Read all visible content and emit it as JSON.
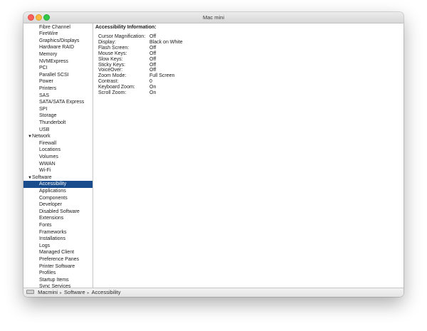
{
  "window": {
    "title": "Mac mini"
  },
  "sidebar": {
    "items": [
      {
        "label": "Fibre Channel",
        "level": "sub"
      },
      {
        "label": "FireWire",
        "level": "sub"
      },
      {
        "label": "Graphics/Displays",
        "level": "sub"
      },
      {
        "label": "Hardware RAID",
        "level": "sub"
      },
      {
        "label": "Memory",
        "level": "sub"
      },
      {
        "label": "NVMExpress",
        "level": "sub"
      },
      {
        "label": "PCI",
        "level": "sub"
      },
      {
        "label": "Parallel SCSI",
        "level": "sub"
      },
      {
        "label": "Power",
        "level": "sub"
      },
      {
        "label": "Printers",
        "level": "sub"
      },
      {
        "label": "SAS",
        "level": "sub"
      },
      {
        "label": "SATA/SATA Express",
        "level": "sub"
      },
      {
        "label": "SPI",
        "level": "sub"
      },
      {
        "label": "Storage",
        "level": "sub"
      },
      {
        "label": "Thunderbolt",
        "level": "sub"
      },
      {
        "label": "USB",
        "level": "sub"
      },
      {
        "label": "Network",
        "level": "cat",
        "expanded_glyph": "▼"
      },
      {
        "label": "Firewall",
        "level": "sub"
      },
      {
        "label": "Locations",
        "level": "sub"
      },
      {
        "label": "Volumes",
        "level": "sub"
      },
      {
        "label": "WWAN",
        "level": "sub"
      },
      {
        "label": "Wi-Fi",
        "level": "sub"
      },
      {
        "label": "Software",
        "level": "cat",
        "expanded_glyph": "▼"
      },
      {
        "label": "Accessibility",
        "level": "sub",
        "selected": true
      },
      {
        "label": "Applications",
        "level": "sub"
      },
      {
        "label": "Components",
        "level": "sub"
      },
      {
        "label": "Developer",
        "level": "sub"
      },
      {
        "label": "Disabled Software",
        "level": "sub"
      },
      {
        "label": "Extensions",
        "level": "sub"
      },
      {
        "label": "Fonts",
        "level": "sub"
      },
      {
        "label": "Frameworks",
        "level": "sub"
      },
      {
        "label": "Installations",
        "level": "sub"
      },
      {
        "label": "Logs",
        "level": "sub"
      },
      {
        "label": "Managed Client",
        "level": "sub"
      },
      {
        "label": "Preference Panes",
        "level": "sub"
      },
      {
        "label": "Printer Software",
        "level": "sub"
      },
      {
        "label": "Profiles",
        "level": "sub"
      },
      {
        "label": "Startup Items",
        "level": "sub"
      },
      {
        "label": "Sync Services",
        "level": "sub"
      }
    ]
  },
  "detail": {
    "heading": "Accessibility Information:",
    "rows": [
      {
        "key": "Cursor Magnification:",
        "value": "Off"
      },
      {
        "key": "Display:",
        "value": "Black on White"
      },
      {
        "key": "Flash Screen:",
        "value": "Off"
      },
      {
        "key": "Mouse Keys:",
        "value": "Off"
      },
      {
        "key": "Slow Keys:",
        "value": "Off"
      },
      {
        "key": "Sticky Keys:",
        "value": "Off"
      },
      {
        "key": "VoiceOver:",
        "value": "Off"
      },
      {
        "key": "Zoom Mode:",
        "value": "Full Screen"
      },
      {
        "key": "Contrast:",
        "value": "0"
      },
      {
        "key": "Keyboard Zoom:",
        "value": "On"
      },
      {
        "key": "Scroll Zoom:",
        "value": "On"
      }
    ]
  },
  "statusbar": {
    "path": [
      "Macmini",
      "Software",
      "Accessibility"
    ],
    "separator": "▸"
  },
  "colors": {
    "selection": "#184c8c",
    "close": "#fc605b",
    "minimize": "#fdbc40",
    "zoom": "#34c84a"
  }
}
